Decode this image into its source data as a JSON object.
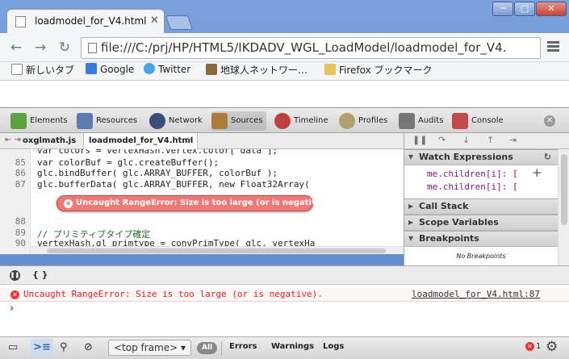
{
  "window": {
    "min_label": "─",
    "max_label": "□",
    "close_label": "✕"
  },
  "tab": {
    "title": "loadmodel_for_V4.html",
    "close": "✕"
  },
  "toolbar": {
    "back": "←",
    "forward": "→",
    "reload": "↻",
    "url": "file:///C:/prj/HP/HTML5/IKDADV_WGL_LoadModel/loadmodel_for_V4."
  },
  "bookmarks": [
    {
      "label": "新しいタブ",
      "icon": "page-icon"
    },
    {
      "label": "Google",
      "icon": "google-icon"
    },
    {
      "label": "Twitter",
      "icon": "twitter-icon"
    },
    {
      "label": "地球人ネットワー…",
      "icon": "site-icon"
    },
    {
      "label": "Firefox ブックマーク",
      "icon": "folder-icon"
    }
  ],
  "devtools": {
    "tabs": [
      {
        "label": "Elements",
        "icon": "elements-icon"
      },
      {
        "label": "Resources",
        "icon": "resources-icon"
      },
      {
        "label": "Network",
        "icon": "network-icon"
      },
      {
        "label": "Sources",
        "icon": "sources-icon",
        "active": true
      },
      {
        "label": "Timeline",
        "icon": "timeline-icon"
      },
      {
        "label": "Profiles",
        "icon": "profiles-icon"
      },
      {
        "label": "Audits",
        "icon": "audits-icon"
      },
      {
        "label": "Console",
        "icon": "console-icon"
      }
    ],
    "close": "✕"
  },
  "sources": {
    "file_tabs": [
      "oxglmath.js",
      "loadmodel_for_V4.html"
    ],
    "file_tab_close": "✕",
    "nav": "⇤ ⇥",
    "lines": [
      {
        "n": "85",
        "text": "var colorBuf = glc.createBuffer();"
      },
      {
        "n": "86",
        "text": "glc.bindBuffer( glc.ARRAY_BUFFER, colorBuf );"
      },
      {
        "n": "87",
        "text": "glc.bufferData( glc.ARRAY_BUFFER, new Float32Array("
      },
      {
        "n": "88",
        "text": ""
      },
      {
        "n": "89",
        "text": "// プリミティブタイプ確定"
      },
      {
        "n": "90",
        "text": "vertexHash.gl_primtype = convPrimType( glc, vertexHa"
      }
    ],
    "partial_line": "var colors = vertexHash.vertex.color[ data ];",
    "error_bubble": "Uncaught RangeError: Size is too large (or is negative)."
  },
  "sidebar": {
    "panes": [
      {
        "label": "Watch Expressions",
        "expanded": true
      },
      {
        "label": "Call Stack",
        "expanded": false
      },
      {
        "label": "Scope Variables",
        "expanded": false
      },
      {
        "label": "Breakpoints",
        "expanded": true
      }
    ],
    "watch": [
      "me.children[i]: [",
      "me.children[i]: ["
    ],
    "no_breakpoints": "No Breakpoints",
    "refresh": "↻",
    "add": "+"
  },
  "drawer": {
    "obj_label": "{ }"
  },
  "console": {
    "error_text": "Uncaught RangeError: Size is too large (or is negative).",
    "error_source": "loadmodel_for_V4.html:87",
    "prompt": "›"
  },
  "statusbar": {
    "frame": "<top frame>",
    "frame_arrow": "▾",
    "all": "All",
    "filters": [
      "Errors",
      "Warnings",
      "Logs"
    ],
    "error_count": "1"
  },
  "colors": {
    "error_red": "#e02020",
    "accent_blue": "#2f6ab5",
    "frame_blue": "#6d8fc8"
  }
}
